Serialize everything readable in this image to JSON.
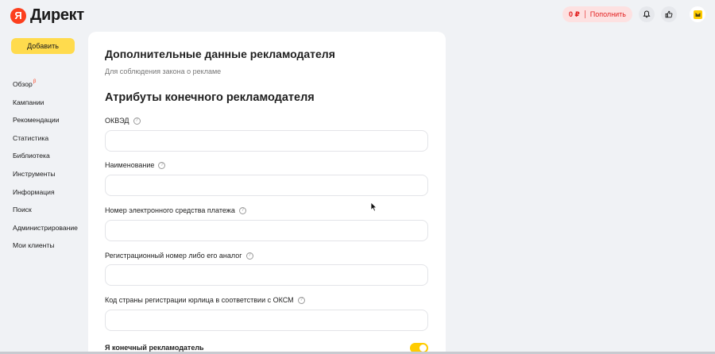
{
  "header": {
    "logo_letter": "Я",
    "logo_text": "Директ",
    "balance_amount": "0 ₽",
    "pay_label": "Пополнить",
    "icons": [
      "bell-icon",
      "thumbs-up-icon",
      "avatar"
    ]
  },
  "sidebar": {
    "add_label": "Добавить",
    "items": [
      {
        "label": "Обзор",
        "badge": "β"
      },
      {
        "label": "Кампании"
      },
      {
        "label": "Рекомендации"
      },
      {
        "label": "Статистика"
      },
      {
        "label": "Библиотека"
      },
      {
        "label": "Инструменты"
      },
      {
        "label": "Информация"
      },
      {
        "label": "Поиск"
      },
      {
        "label": "Администрирование"
      },
      {
        "label": "Мои клиенты"
      }
    ]
  },
  "form": {
    "title": "Дополнительные данные рекламодателя",
    "subtitle": "Для соблюдения закона о рекламе",
    "section_title": "Атрибуты конечного рекламодателя",
    "fields": [
      {
        "label": "ОКВЭД",
        "value": ""
      },
      {
        "label": "Наименование",
        "value": ""
      },
      {
        "label": "Номер электронного средства платежа",
        "value": ""
      },
      {
        "label": "Регистрационный номер либо его аналог",
        "value": ""
      },
      {
        "label": "Код страны регистрации юрлица в соответствии с ОКСМ",
        "value": ""
      }
    ],
    "final_label": "Я конечный рекламодатель",
    "final_toggle_on": true
  },
  "colors": {
    "accent_yellow": "#ffdb4d",
    "balance_red": "#e21e1e",
    "brand_red": "#fc3f1d",
    "toggle_on": "#ffcc00"
  }
}
